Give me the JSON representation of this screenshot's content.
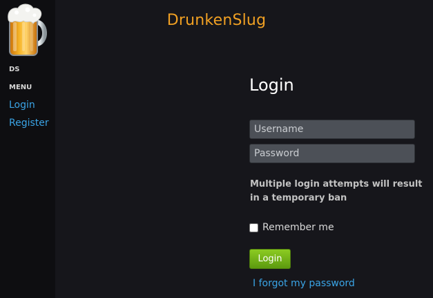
{
  "header": {
    "site_title": "DrunkenSlug"
  },
  "sidebar": {
    "ds_label": "DS",
    "menu_label": "MENU",
    "items": [
      {
        "label": "Login"
      },
      {
        "label": "Register"
      }
    ]
  },
  "login_form": {
    "heading": "Login",
    "username_placeholder": "Username",
    "username_value": "",
    "password_placeholder": "Password",
    "password_value": "",
    "warning": "Multiple login attempts will result in a temporary ban",
    "remember_label": "Remember me",
    "remember_checked": false,
    "submit_label": "Login",
    "forgot_label": "I forgot my password"
  },
  "colors": {
    "title": "#f0a023",
    "link": "#3aa4e6",
    "button": "#6fae16",
    "background": "#16161b"
  },
  "icons": {
    "logo": "beer-mug-icon"
  }
}
